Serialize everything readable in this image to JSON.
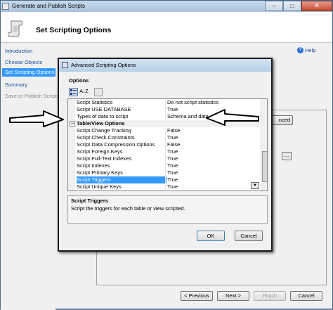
{
  "window": {
    "title": "Generate and Publish Scripts",
    "minimize": "–",
    "maximize": "□",
    "close": "✕"
  },
  "header": {
    "title": "Set Scripting Options"
  },
  "nav": {
    "items": [
      {
        "label": "Introduction",
        "state": "normal"
      },
      {
        "label": "Choose Objects",
        "state": "normal"
      },
      {
        "label": "Set Scripting Options",
        "state": "active"
      },
      {
        "label": "Summary",
        "state": "normal"
      },
      {
        "label": "Save or Publish Scripts",
        "state": "disabled"
      }
    ]
  },
  "help": {
    "label": "Help",
    "icon": "?"
  },
  "background_buttons": {
    "advanced_partial": "nced",
    "browse": "..."
  },
  "wizard_buttons": {
    "previous": "< Previous",
    "next": "Next >",
    "finish": "Finish",
    "cancel": "Cancel"
  },
  "dialog": {
    "title": "Advanced Scripting Options",
    "options_label": "Options",
    "sort_az": "A↓Z",
    "rows": [
      {
        "name": "Script Statistics",
        "value": "Do not script statistics"
      },
      {
        "name": "Script USE DATABASE",
        "value": "True"
      },
      {
        "name": "Types of data to script",
        "value": "Schema and data"
      },
      {
        "name": "Table/View Options",
        "value": "",
        "section": true
      },
      {
        "name": "Script Change Tracking",
        "value": "False"
      },
      {
        "name": "Script Check Constraints",
        "value": "True"
      },
      {
        "name": "Script Data Compression Options",
        "value": "False"
      },
      {
        "name": "Script Foreign Keys",
        "value": "True"
      },
      {
        "name": "Script Full-Text Indexes",
        "value": "True"
      },
      {
        "name": "Script Indexes",
        "value": "True"
      },
      {
        "name": "Script Primary Keys",
        "value": "True"
      },
      {
        "name": "Script Triggers",
        "value": "True",
        "selected": true
      },
      {
        "name": "Script Unique Keys",
        "value": "True"
      }
    ],
    "collapse_symbol": "−",
    "dropdown_symbol": "▼",
    "description": {
      "title": "Script Triggers",
      "text": "Script the triggers for each table or view scripted."
    },
    "ok": "OK",
    "cancel": "Cancel"
  },
  "colors": {
    "selection": "#3399ff",
    "nav_link": "#1a4fa0",
    "title_bar": "#b8cfe6"
  }
}
